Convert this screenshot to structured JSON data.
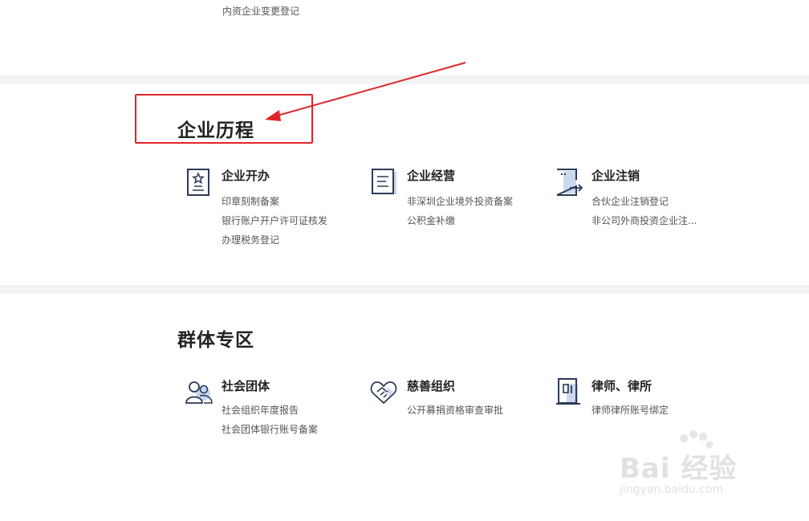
{
  "top_link": "内资企业变更登记",
  "sections": {
    "history": {
      "title": "企业历程",
      "cards": [
        {
          "name": "企业开办",
          "icon": "certificate-icon",
          "links": [
            "印章刻制备案",
            "银行账户开户许可证核发",
            "办理税务登记"
          ]
        },
        {
          "name": "企业经营",
          "icon": "document-list-icon",
          "links": [
            "非深圳企业境外投资备案",
            "公积金补缴"
          ]
        },
        {
          "name": "企业注销",
          "icon": "exit-icon",
          "links": [
            "合伙企业注销登记",
            "非公司外商投资企业注..."
          ]
        }
      ]
    },
    "groups": {
      "title": "群体专区",
      "cards": [
        {
          "name": "社会团体",
          "icon": "group-people-icon",
          "links": [
            "社会组织年度报告",
            "社会团体银行账号备案"
          ]
        },
        {
          "name": "慈善组织",
          "icon": "heart-handshake-icon",
          "links": [
            "公开募捐资格审查审批"
          ]
        },
        {
          "name": "律师、律所",
          "icon": "law-office-icon",
          "links": [
            "律师律所账号绑定"
          ]
        }
      ]
    }
  },
  "watermark": {
    "brand": "Bai 经验",
    "url": "jingyan.baidu.com"
  },
  "colors": {
    "annotation": "#e0252a",
    "icon_stroke": "#2b3a57",
    "icon_fill": "#c9d8ee",
    "band": "#f2f3f5"
  }
}
